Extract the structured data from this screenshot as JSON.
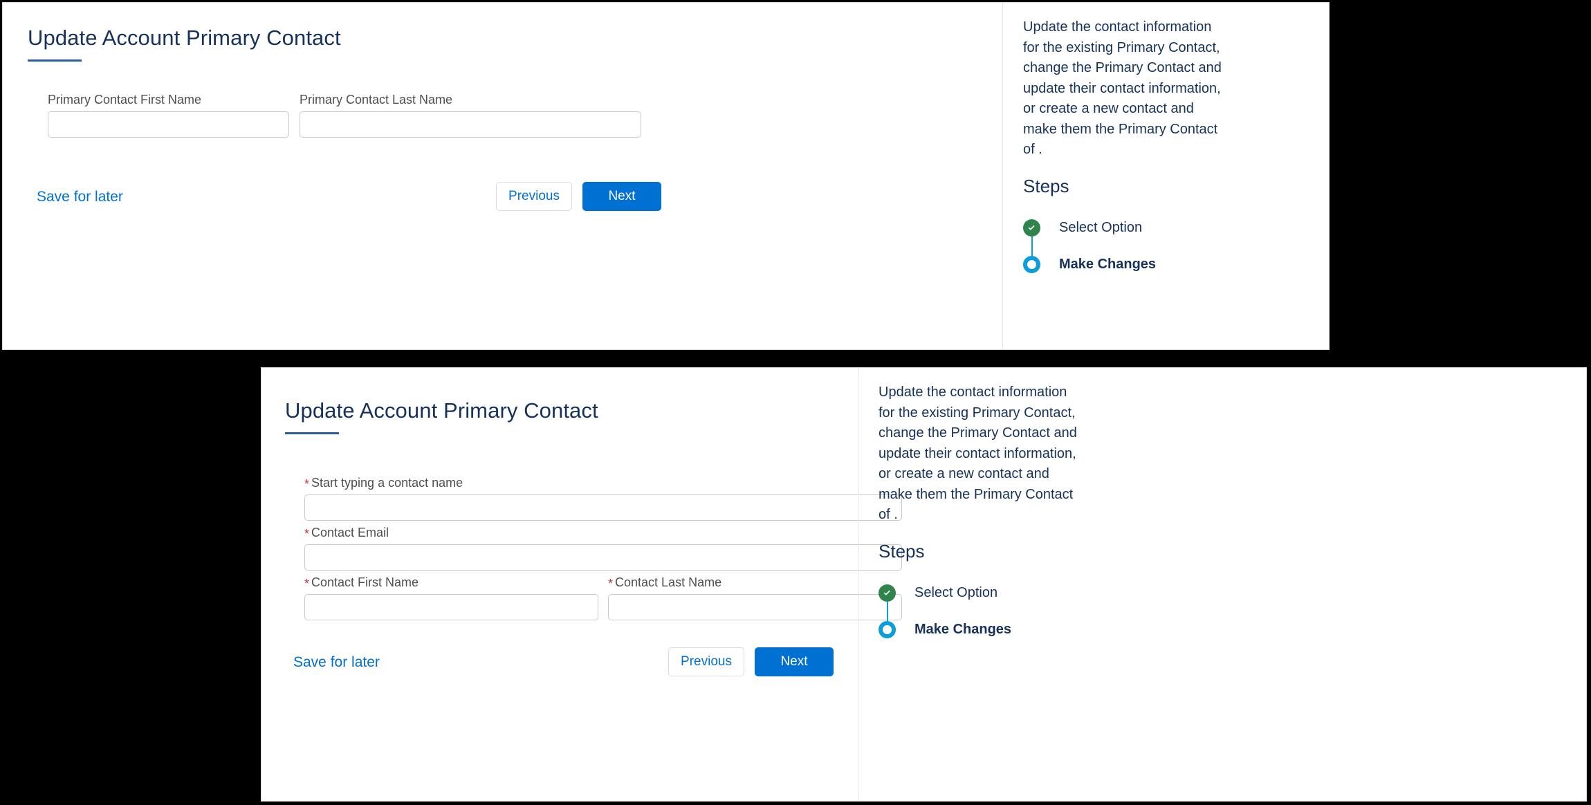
{
  "panels": [
    {
      "id": "existing-contact-step",
      "heading": "Update Account Primary Contact",
      "fields": [
        {
          "label": "Primary Contact First Name",
          "required": false,
          "value": "",
          "placeholder": ""
        },
        {
          "label": "Primary Contact Last Name",
          "required": false,
          "value": "",
          "placeholder": ""
        }
      ],
      "footer": {
        "save_label": "Save for later",
        "previous_label": "Previous",
        "next_label": "Next"
      },
      "sidebar": {
        "description": "Update the contact information for the existing Primary Contact, change the Primary Contact and update their contact information, or create a new contact and make them the Primary Contact of .",
        "steps_title": "Steps",
        "steps": [
          {
            "label": "Select Option",
            "state": "done",
            "icon": "check-circle-icon"
          },
          {
            "label": "Make Changes",
            "state": "active",
            "icon": "radio-current-icon"
          }
        ]
      }
    },
    {
      "id": "new-contact-step",
      "heading": "Update Account Primary Contact",
      "fields": [
        {
          "label": "Start typing a contact name",
          "required": true,
          "value": "",
          "placeholder": ""
        },
        {
          "label": "Contact Email",
          "required": true,
          "value": "",
          "placeholder": ""
        },
        {
          "label": "Contact First Name",
          "required": true,
          "value": "",
          "placeholder": ""
        },
        {
          "label": "Contact Last Name",
          "required": true,
          "value": "",
          "placeholder": ""
        }
      ],
      "footer": {
        "save_label": "Save for later",
        "previous_label": "Previous",
        "next_label": "Next"
      },
      "sidebar": {
        "description": "Update the contact information for the existing Primary Contact, change the Primary Contact and update their contact information, or create a new contact and make them the Primary Contact of .",
        "steps_title": "Steps",
        "steps": [
          {
            "label": "Select Option",
            "state": "done",
            "icon": "check-circle-icon"
          },
          {
            "label": "Make Changes",
            "state": "active",
            "icon": "radio-current-icon"
          }
        ]
      }
    }
  ],
  "colors": {
    "heading": "#16325c",
    "accent_blue": "#0070d2",
    "rule_blue": "#2c5aa0",
    "step_done_green": "#2e844a",
    "step_active_blue": "#0d9dda",
    "required_red": "#c23934",
    "label_gray": "#514f4d",
    "input_border": "#c9c9c9",
    "page_background": "#000000",
    "panel_background": "#ffffff"
  }
}
